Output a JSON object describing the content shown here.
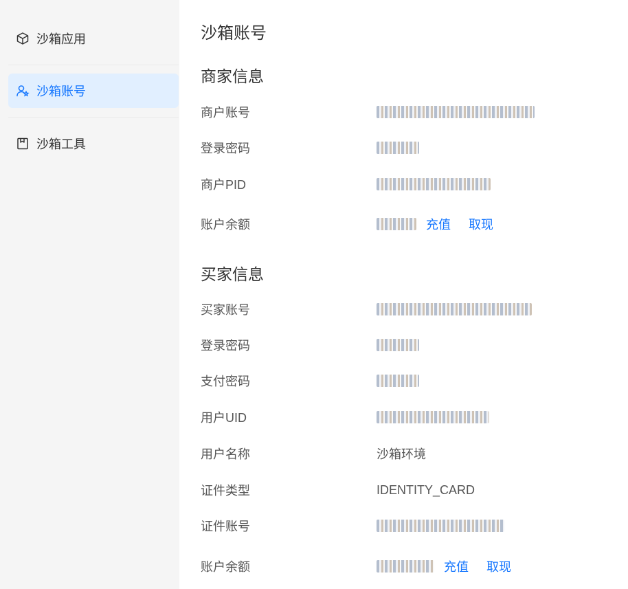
{
  "sidebar": {
    "items": [
      {
        "label": "沙箱应用",
        "icon": "box-icon"
      },
      {
        "label": "沙箱账号",
        "icon": "user-star-icon"
      },
      {
        "label": "沙箱工具",
        "icon": "bookmark-icon"
      }
    ]
  },
  "page": {
    "title": "沙箱账号"
  },
  "merchant": {
    "title": "商家信息",
    "rows": [
      {
        "label": "商户账号"
      },
      {
        "label": "登录密码"
      },
      {
        "label": "商户PID"
      },
      {
        "label": "账户余额",
        "recharge": "充值",
        "withdraw": "取现"
      }
    ]
  },
  "buyer": {
    "title": "买家信息",
    "rows": [
      {
        "label": "买家账号"
      },
      {
        "label": "登录密码"
      },
      {
        "label": "支付密码"
      },
      {
        "label": "用户UID"
      },
      {
        "label": "用户名称",
        "value": "沙箱环境"
      },
      {
        "label": "证件类型",
        "value": "IDENTITY_CARD"
      },
      {
        "label": "证件账号"
      },
      {
        "label": "账户余额",
        "recharge": "充值",
        "withdraw": "取现"
      }
    ]
  }
}
